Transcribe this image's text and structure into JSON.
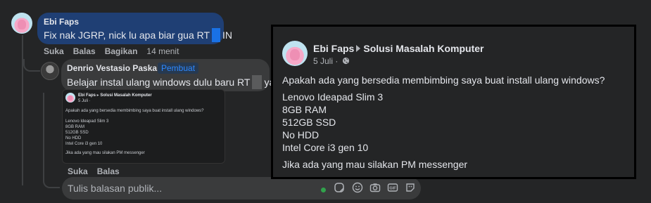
{
  "comment1": {
    "author": "Ebi Faps",
    "text_before": "Fix nak JGRP, nick lu apa biar gua RT",
    "text_after": "IN",
    "actions": {
      "like": "Suka",
      "reply": "Balas",
      "share": "Bagikan",
      "time": "14 menit"
    }
  },
  "comment2": {
    "author": "Denrio Vestasio Paskah",
    "badge": "Pembuat",
    "text_before": "Belajar instal ulang windows dulu baru RT",
    "text_after": "ya..",
    "actions": {
      "like": "Suka",
      "reply": "Balas"
    }
  },
  "post": {
    "author": "Ebi Faps",
    "group": "Solusi Masalah Komputer",
    "date": "5 Juli ·",
    "question": "Apakah ada yang bersedia membimbing saya buat install ulang windows?",
    "specs": [
      "Lenovo Ideapad Slim 3",
      "8GB RAM",
      "512GB SSD",
      "No HDD",
      "Intel Core i3 gen 10"
    ],
    "closing": "Jika ada yang mau silakan PM messenger"
  },
  "reply_box": {
    "placeholder": "Tulis balasan publik..."
  },
  "icons": [
    "globe-icon",
    "sticker-icon",
    "emoji-icon",
    "camera-icon",
    "gif-icon",
    "avatar-sticker-icon"
  ],
  "colors": {
    "bubble_author": "#1f3f74",
    "bubble_other": "#3a3b3c",
    "badge": "#2d88ff",
    "online": "#31a24c",
    "background": "#242526"
  }
}
